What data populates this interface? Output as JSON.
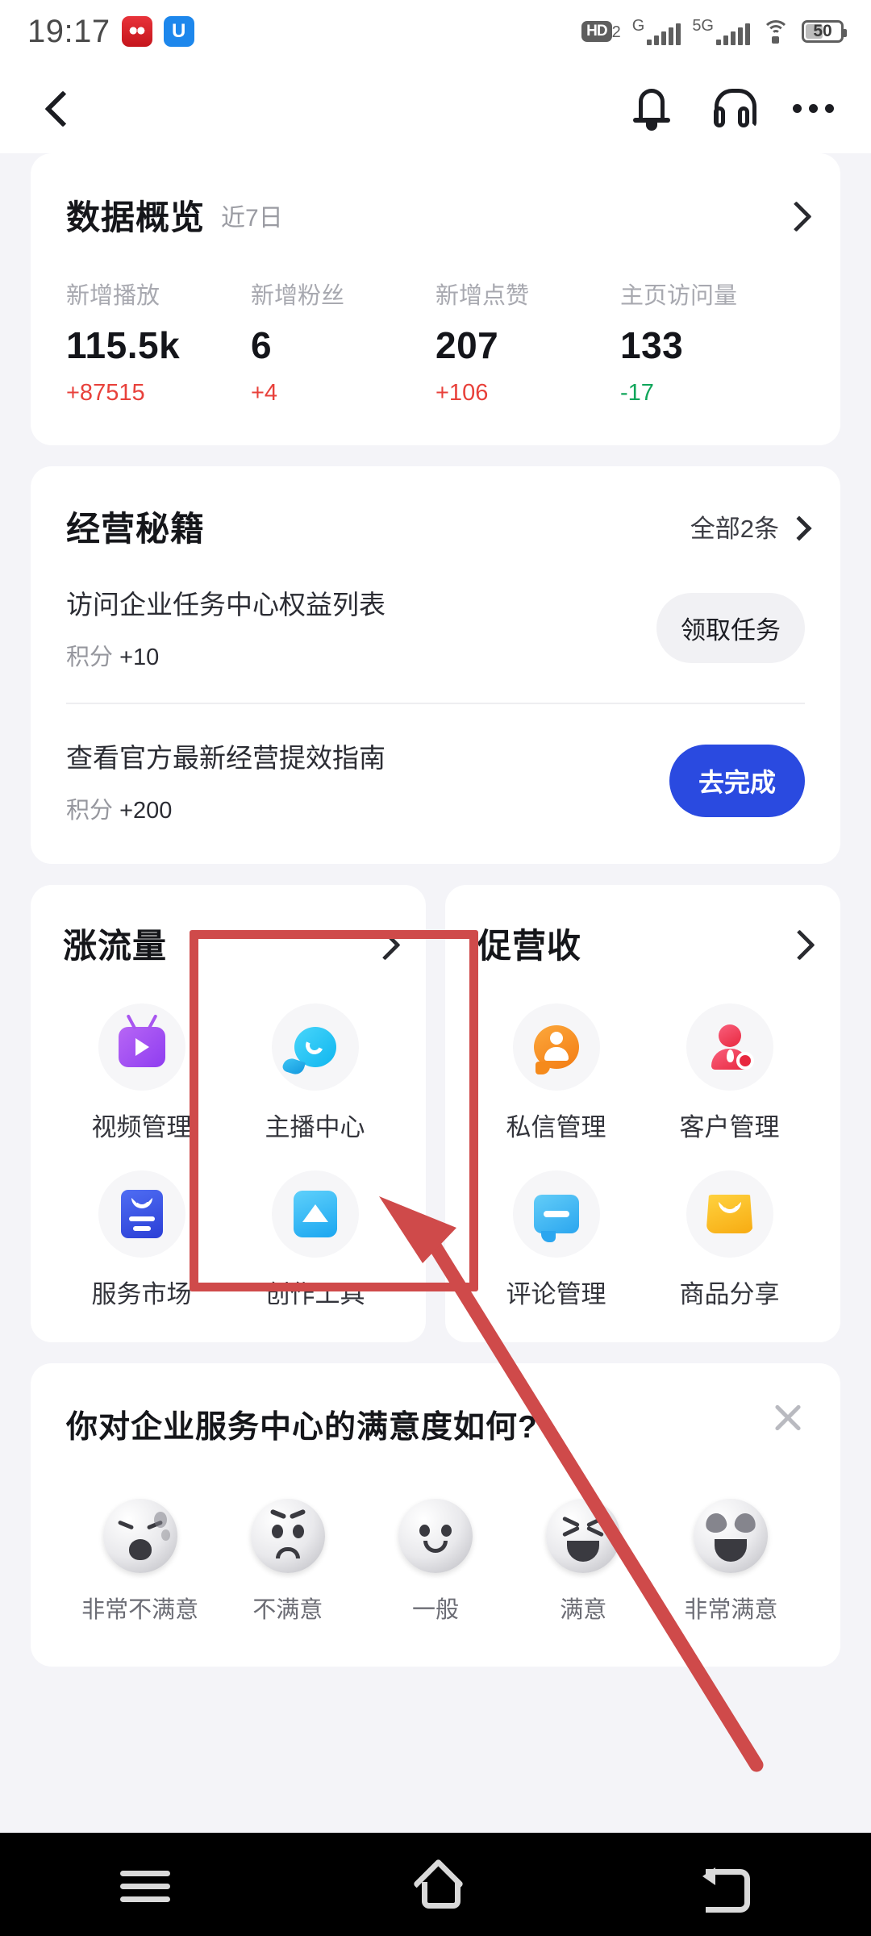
{
  "statusbar": {
    "time": "19:17",
    "app_badge_1": "app-badge-red",
    "app_badge_2": "U",
    "hd_label": "HD",
    "hd_sub": "2",
    "net1_label": "G",
    "net2_label": "5G",
    "battery_level": "50"
  },
  "navbar": {
    "back": "back-icon",
    "bell": "notification-bell-icon",
    "headset": "customer-service-icon",
    "more": "more-options-icon"
  },
  "overview": {
    "title": "数据概览",
    "subtitle": "近7日",
    "metrics": [
      {
        "label": "新增播放",
        "value": "115.5k",
        "delta": "+87515",
        "dir": "up"
      },
      {
        "label": "新增粉丝",
        "value": "6",
        "delta": "+4",
        "dir": "up"
      },
      {
        "label": "新增点赞",
        "value": "207",
        "delta": "+106",
        "dir": "up"
      },
      {
        "label": "主页访问量",
        "value": "133",
        "delta": "-17",
        "dir": "down"
      }
    ]
  },
  "tips": {
    "title": "经营秘籍",
    "all_label": "全部2条",
    "tasks": [
      {
        "title": "访问企业任务中心权益列表",
        "points_label": "积分",
        "points": "+10",
        "action": "领取任务",
        "style": "ghost"
      },
      {
        "title": "查看官方最新经营提效指南",
        "points_label": "积分",
        "points": "+200",
        "action": "去完成",
        "style": "blue"
      }
    ]
  },
  "feature_cards": [
    {
      "title": "涨流量",
      "items": [
        {
          "name": "视频管理",
          "icon": "video-manage-icon"
        },
        {
          "name": "主播中心",
          "icon": "anchor-center-icon"
        },
        {
          "name": "服务市场",
          "icon": "service-market-icon"
        },
        {
          "name": "创作工具",
          "icon": "creation-tools-icon"
        }
      ]
    },
    {
      "title": "促营收",
      "items": [
        {
          "name": "私信管理",
          "icon": "direct-message-icon"
        },
        {
          "name": "客户管理",
          "icon": "customer-manage-icon"
        },
        {
          "name": "评论管理",
          "icon": "comment-manage-icon"
        },
        {
          "name": "商品分享",
          "icon": "product-share-icon"
        }
      ]
    }
  ],
  "survey": {
    "question": "你对企业服务中心的满意度如何?",
    "close": "close-icon",
    "options": [
      {
        "label": "非常不满意",
        "face": "very-dissatisfied"
      },
      {
        "label": "不满意",
        "face": "dissatisfied"
      },
      {
        "label": "一般",
        "face": "neutral"
      },
      {
        "label": "满意",
        "face": "satisfied"
      },
      {
        "label": "非常满意",
        "face": "very-satisfied"
      }
    ]
  },
  "system_nav": {
    "recents": "recents-icon",
    "home": "home-icon",
    "back": "back-icon"
  },
  "annotation": {
    "color": "#cf4a4a",
    "target": "主播中心"
  }
}
